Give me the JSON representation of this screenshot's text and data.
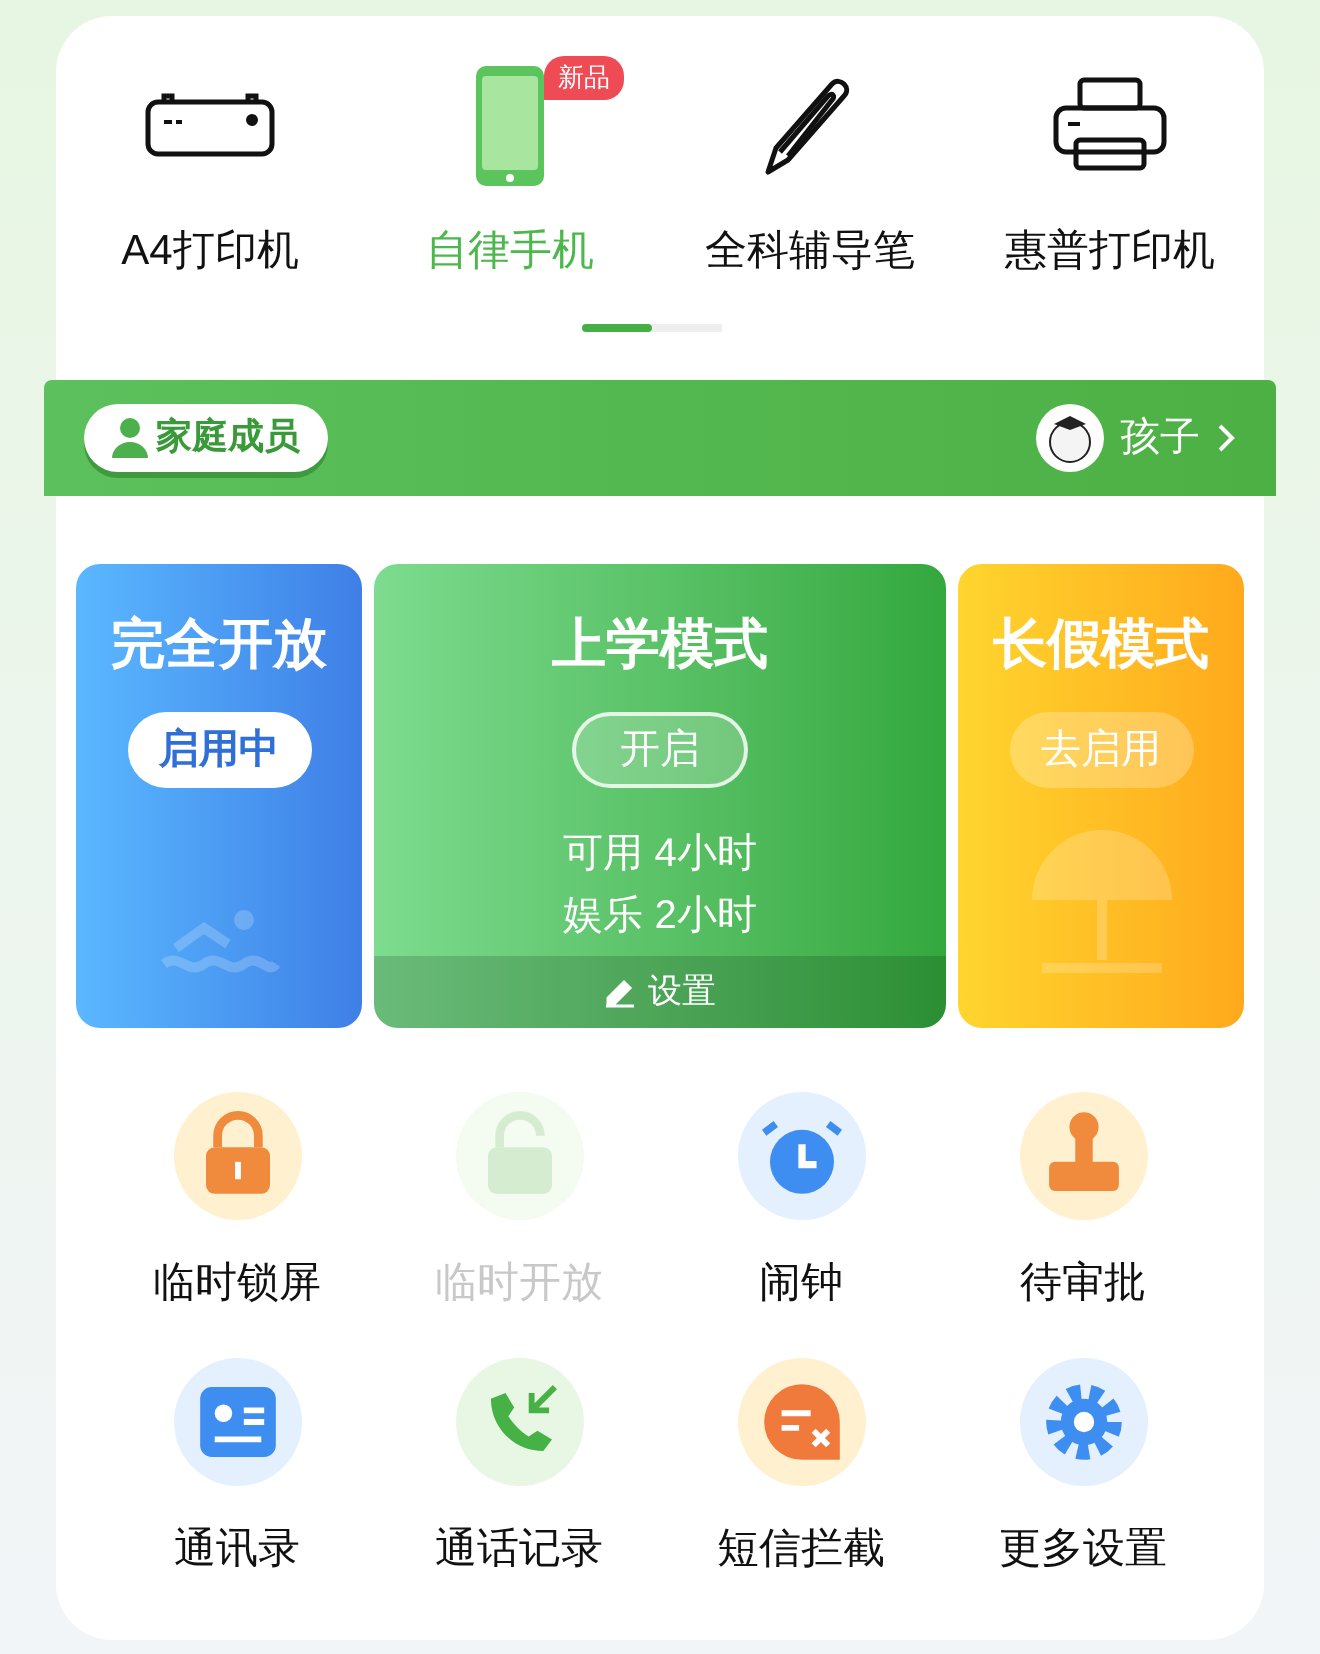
{
  "devices": [
    {
      "kind": "a4-printer",
      "label": "A4打印机",
      "selected": false
    },
    {
      "kind": "phone",
      "label": "自律手机",
      "selected": true,
      "badge": "新品"
    },
    {
      "kind": "pen",
      "label": "全科辅导笔",
      "selected": false
    },
    {
      "kind": "printer",
      "label": "惠普打印机",
      "selected": false
    }
  ],
  "pager": [
    {
      "selected": true
    },
    {
      "selected": false
    }
  ],
  "family": {
    "button": "家庭成员",
    "member": "孩子"
  },
  "modes": [
    {
      "kind": "open",
      "title": "完全开放",
      "button": "启用中",
      "selected": true,
      "expanded": false
    },
    {
      "kind": "school",
      "title": "上学模式",
      "button": "开启",
      "selected": false,
      "expanded": true,
      "lines": [
        "可用 4小时",
        "娱乐 2小时"
      ],
      "settings": "设置"
    },
    {
      "kind": "holiday",
      "title": "长假模式",
      "button": "去启用",
      "selected": false,
      "expanded": false
    }
  ],
  "tools": [
    {
      "kind": "lock",
      "label": "临时锁屏",
      "disabled": false
    },
    {
      "kind": "unlock",
      "label": "临时开放",
      "disabled": true
    },
    {
      "kind": "alarm",
      "label": "闹钟",
      "disabled": false
    },
    {
      "kind": "stamp",
      "label": "待审批",
      "disabled": false
    },
    {
      "kind": "contacts",
      "label": "通讯录",
      "disabled": false
    },
    {
      "kind": "calls",
      "label": "通话记录",
      "disabled": false
    },
    {
      "kind": "sms-block",
      "label": "短信拦截",
      "disabled": false
    },
    {
      "kind": "gear",
      "label": "更多设置",
      "disabled": false
    }
  ]
}
